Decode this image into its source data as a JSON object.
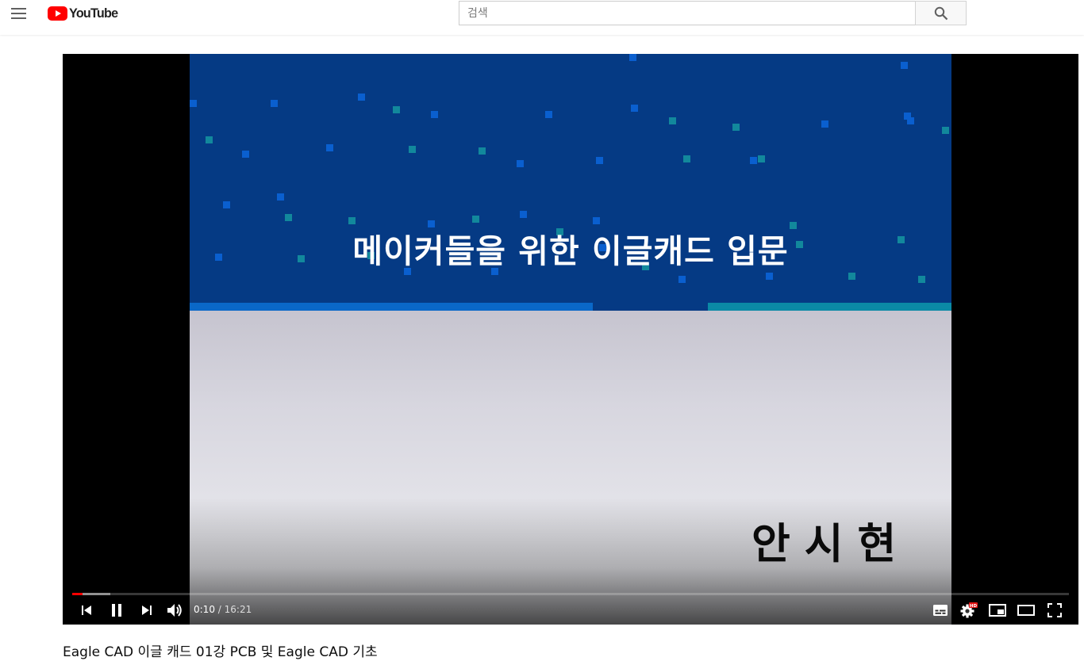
{
  "masthead": {
    "brand": "YouTube",
    "search_placeholder": "검색"
  },
  "slide": {
    "title": "메이커들을 위한 이글캐드 입문",
    "author": "안시현"
  },
  "player": {
    "current_time": "0:10",
    "separator": " / ",
    "duration": "16:21",
    "played_fraction": 0.0102,
    "loaded_fraction": 0.038,
    "quality_badge": "HD"
  },
  "video": {
    "title": "Eagle CAD 이글 캐드 01강 PCB 및 Eagle CAD 기초"
  },
  "colors": {
    "brand_red": "#ff0000",
    "slide_blue": "#053a84",
    "slide_stripe_blue": "#0a68c8",
    "slide_stripe_teal": "#0b8aa6"
  },
  "icons": {
    "menu": "hamburger-menu-icon",
    "logo": "youtube-logo-icon",
    "search": "magnifier-search-icon",
    "previous": "skip-previous-icon",
    "pause": "pause-icon",
    "next": "skip-next-icon",
    "volume": "volume-icon",
    "subtitles": "subtitles-icon",
    "settings": "gear-icon",
    "miniplayer": "miniplayer-icon",
    "theater": "theater-mode-icon",
    "fullscreen": "fullscreen-icon"
  }
}
